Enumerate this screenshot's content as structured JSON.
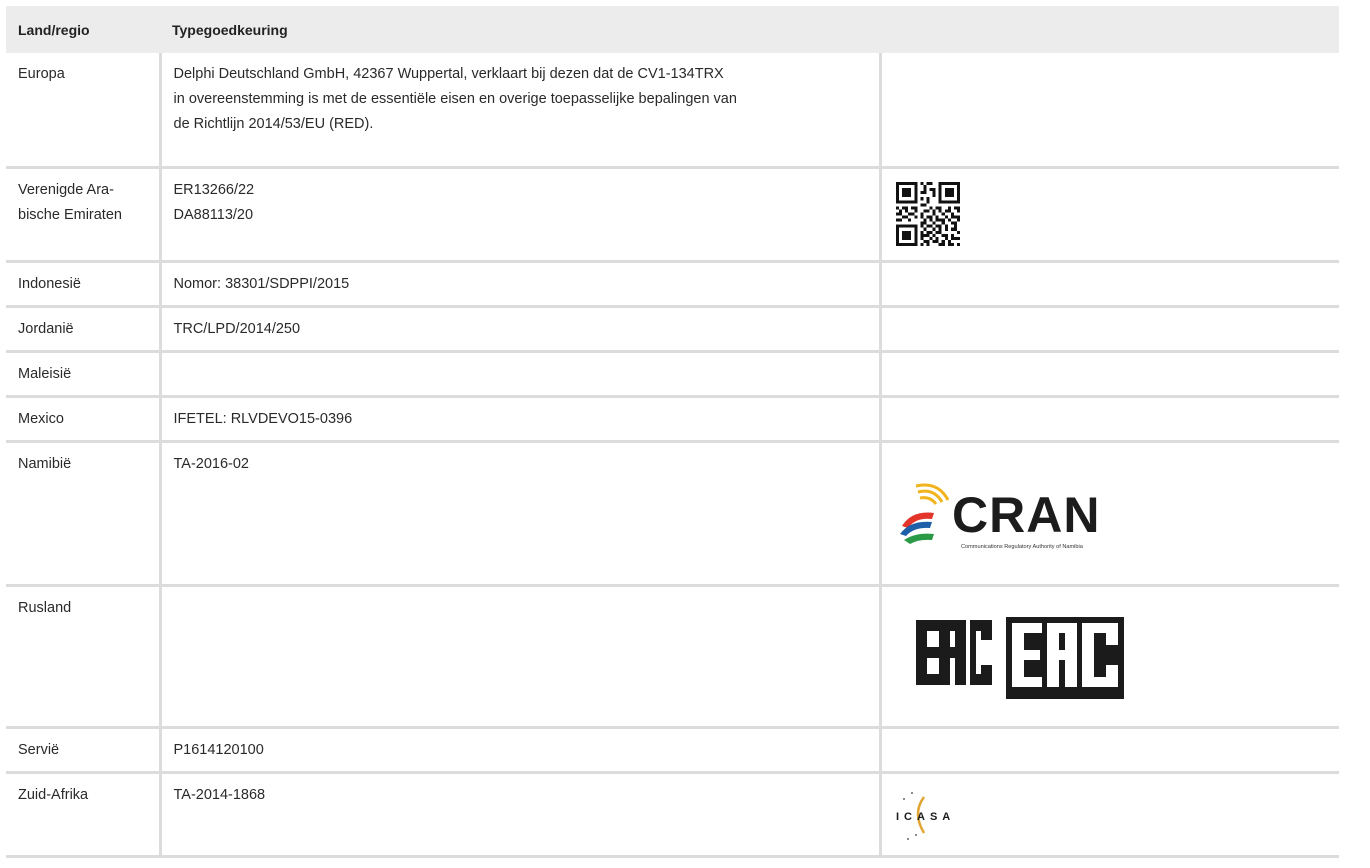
{
  "table": {
    "headers": [
      "Land/regio",
      "Typegoedkeuring",
      ""
    ],
    "rows": [
      {
        "region": "Europa",
        "approval": "Delphi Deutschland GmbH, 42367 Wuppertal, verklaart bij dezen dat de CV1-134TRX\nin overeenstemming is met de essentiële eisen en overige toepasselijke bepalingen van\nde Richtlijn 2014/53/EU (RED).",
        "mark": ""
      },
      {
        "region": "Verenigde Ara-\nbische Emiraten",
        "approval": "ER13266/22\nDA88113/20",
        "mark": "qr-code"
      },
      {
        "region": "Indonesië",
        "approval": "Nomor: 38301/SDPPI/2015",
        "mark": ""
      },
      {
        "region": "Jordanië",
        "approval": "TRC/LPD/2014/250",
        "mark": ""
      },
      {
        "region": "Maleisië",
        "approval": "",
        "mark": ""
      },
      {
        "region": "Mexico",
        "approval": "IFETEL: RLVDEVO15-0396",
        "mark": ""
      },
      {
        "region": "Namibië",
        "approval": "TA-2016-02",
        "mark": "cran-logo"
      },
      {
        "region": "Rusland",
        "approval": "",
        "mark": "eac-logo"
      },
      {
        "region": "Servië",
        "approval": "P1614120100",
        "mark": ""
      },
      {
        "region": "Zuid-Afrika",
        "approval": "TA-2014-1868",
        "mark": "icasa-logo"
      }
    ]
  },
  "logos": {
    "cran": {
      "name": "CRAN",
      "subtitle": "Communications Regulatory Authority of Namibia"
    },
    "eac": {
      "text": "EAC"
    },
    "icasa": {
      "text": "ICASA"
    }
  }
}
